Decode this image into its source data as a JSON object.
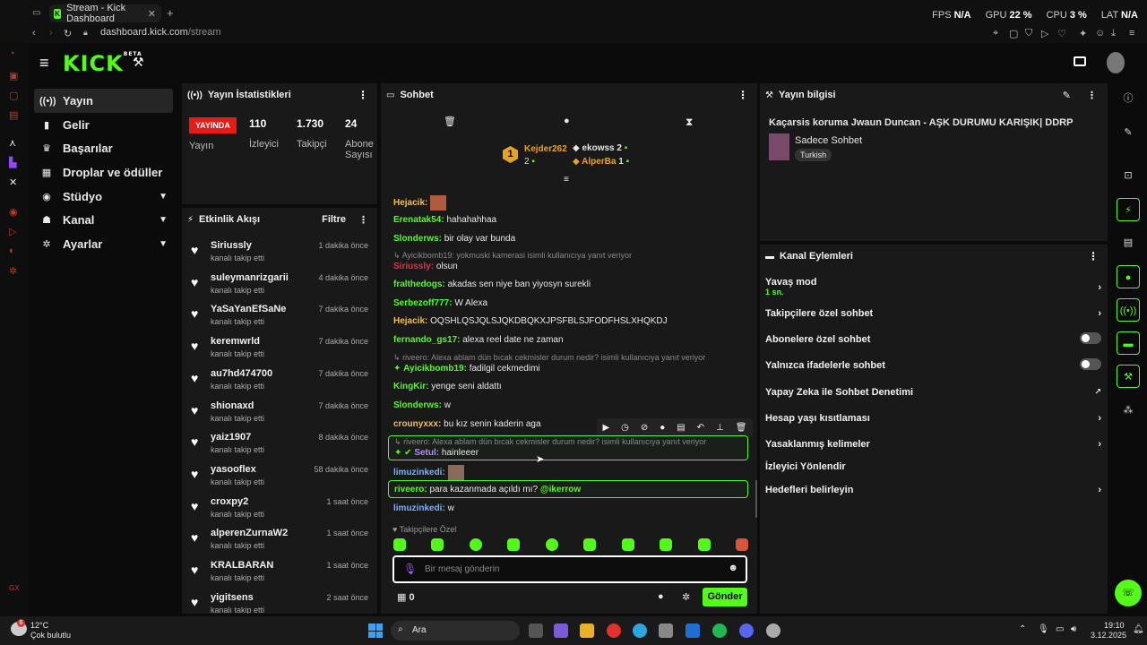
{
  "browser": {
    "tab_title": "Stream - Kick Dashboard",
    "url_domain": "dashboard.kick.com",
    "url_path": "/stream",
    "fps_label": "FPS",
    "fps_value": "N/A",
    "gpu_label": "GPU",
    "gpu_value": "22 %",
    "cpu_label": "CPU",
    "cpu_value": "3 %",
    "lat_label": "LAT",
    "lat_value": "N/A"
  },
  "header": {
    "logo": "KICK",
    "logo_badge": "BETA"
  },
  "nav": [
    {
      "label": "Yayın",
      "icon": "broadcast-icon"
    },
    {
      "label": "Gelir",
      "icon": "money-icon"
    },
    {
      "label": "Başarılar",
      "icon": "trophy-icon"
    },
    {
      "label": "Droplar ve ödüller",
      "icon": "gift-icon"
    },
    {
      "label": "Stüdyo",
      "icon": "studio-icon"
    },
    {
      "label": "Kanal",
      "icon": "user-icon"
    },
    {
      "label": "Ayarlar",
      "icon": "gear-icon"
    }
  ],
  "stats": {
    "title": "Yayın İstatistikleri",
    "live_badge": "YAYINDA",
    "live_label": "Yayın",
    "viewers_value": "110",
    "viewers_label": "İzleyici",
    "followers_value": "1.730",
    "followers_label": "Takipçi",
    "subs_value": "24",
    "subs_label_1": "Abone",
    "subs_label_2": "Sayısı"
  },
  "activity": {
    "title": "Etkinlik Akışı",
    "filter_label": "Filtre",
    "items": [
      {
        "name": "Siriussly",
        "desc": "kanalı takip etti",
        "time": "1 dakika önce"
      },
      {
        "name": "suleymanrizgarii",
        "desc": "kanalı takip etti",
        "time": "4 dakika önce"
      },
      {
        "name": "YaSaYanEfSaNe",
        "desc": "kanalı takip etti",
        "time": "7 dakika önce"
      },
      {
        "name": "keremwrld",
        "desc": "kanalı takip etti",
        "time": "7 dakika önce"
      },
      {
        "name": "au7hd474700",
        "desc": "kanalı takip etti",
        "time": "7 dakika önce"
      },
      {
        "name": "shionaxd",
        "desc": "kanalı takip etti",
        "time": "7 dakika önce"
      },
      {
        "name": "yaiz1907",
        "desc": "kanalı takip etti",
        "time": "8 dakika önce"
      },
      {
        "name": "yasooflex",
        "desc": "kanalı takip etti",
        "time": "58 dakika önce"
      },
      {
        "name": "croxpy2",
        "desc": "kanalı takip etti",
        "time": "1 saat önce"
      },
      {
        "name": "alperenZurnaW2",
        "desc": "kanalı takip etti",
        "time": "1 saat önce"
      },
      {
        "name": "KRALBARAN",
        "desc": "kanalı takip etti",
        "time": "1 saat önce"
      },
      {
        "name": "yigitsens",
        "desc": "kanalı takip etti",
        "time": "2 saat önce"
      }
    ]
  },
  "chat": {
    "title": "Sohbet",
    "top_gifter": "Kejder262",
    "top_gifter_count": "2",
    "top_rank": "1",
    "gifter2": "ekowss",
    "gifter2_count": "2",
    "gifter3": "AlperBa",
    "gifter3_count": "1",
    "messages": {
      "m1_user": "Hejacik:",
      "m2_user": "Erenatak54:",
      "m2_text": "hahahahhaa",
      "m3_user": "Slonderws:",
      "m3_text": "bir olay var bunda",
      "m4_reply": "Ayicikbomb19: yokmuski kamerasi isimli kullanıcıya yanıt veriyor",
      "m4_user": "Siriussly:",
      "m4_text": "olsun",
      "m5_user": "fralthedogs:",
      "m5_text": "akadas sen niye ban yiyosyn surekli",
      "m6_user": "Serbezoff777:",
      "m6_text": "W Alexa",
      "m7_user": "Hejacik:",
      "m7_text": "OQSHLQSJQLSJQKDBQKXJPSFBLSJFODFHSLXHQKDJ",
      "m8_user": "fernando_gs17:",
      "m8_text": "alexa reel date ne zaman",
      "m9_reply": "riveero: Alexa ablam dün bıcak cekmisler durum nedir? isimli kullanıcıya yanıt veriyor",
      "m9_user": "Ayicikbomb19:",
      "m9_text": "fadilgil cekmedimi",
      "m10_user": "KingKir:",
      "m10_text": "yenge seni aldattı",
      "m11_user": "Slonderws:",
      "m11_text": "w",
      "m12_user": "crounyxxx:",
      "m12_text": "bu kız senin kaderin aga",
      "m13_reply": "riveero: Alexa ablam dün bıcak cekmisler durum nedir? isimli kullanıcıya yanıt veriyor",
      "m13_user": "Setul:",
      "m13_text": "hainleeer",
      "m14_user": "limuzinkedi:",
      "m15_user": "riveero:",
      "m15_text": "para kazanmada açıldı mı?",
      "m15_mention": "@ikerrow",
      "m16_user": "limuzinkedi:",
      "m16_text": "w"
    },
    "followers_only_label": "Takipçilere Özel",
    "input_placeholder": "Bir mesaj gönderin",
    "points": "0",
    "send_label": "Gönder"
  },
  "stream_info": {
    "title": "Yayın bilgisi",
    "stream_title": "Kaçarsis koruma Jwaun Duncan - AŞK DURUMU KARIŞIK| DDRP",
    "category": "Sadece Sohbet",
    "language": "Turkish"
  },
  "channel_actions": {
    "title": "Kanal Eylemleri",
    "slow_mode": "Yavaş mod",
    "slow_mode_value": "1 sn.",
    "followers_chat": "Takipçilere özel sohbet",
    "subs_chat": "Abonelere özel sohbet",
    "emote_chat": "Yalnızca ifadelerle sohbet",
    "ai_moderation": "Yapay Zeka ile Sohbet Denetimi",
    "age_restriction": "Hesap yaşı kısıtlaması",
    "banned_words": "Yasaklanmış kelimeler",
    "viewer_redirect": "İzleyici Yönlendir",
    "set_goals": "Hedefleri belirleyin"
  },
  "taskbar": {
    "weather_temp": "12°C",
    "weather_desc": "Çok bulutlu",
    "search_label": "Ara",
    "time": "19:10",
    "date": "3.12.2025",
    "notif_count": "6"
  },
  "colors": {
    "accent": "#53fc18",
    "live": "#e91916",
    "panel": "#191919"
  }
}
